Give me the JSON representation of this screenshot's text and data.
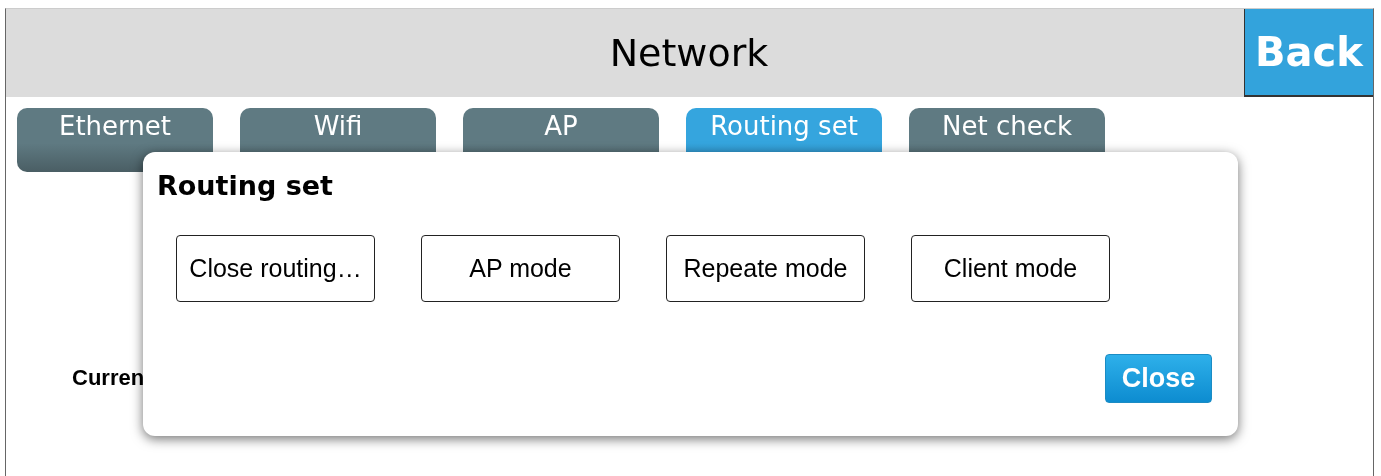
{
  "header": {
    "title": "Network",
    "back_button": "Back"
  },
  "tabs": [
    {
      "label": "Ethernet",
      "selected": false
    },
    {
      "label": "Wifi",
      "selected": false
    },
    {
      "label": "AP",
      "selected": false
    },
    {
      "label": "Routing set",
      "selected": true
    },
    {
      "label": "Net check",
      "selected": false
    }
  ],
  "content": {
    "label": "Curren"
  },
  "dialog": {
    "title": "Routing set",
    "options": [
      "Close routing…",
      "AP mode",
      "Repeate mode",
      "Client mode"
    ],
    "close_button": "Close"
  }
}
